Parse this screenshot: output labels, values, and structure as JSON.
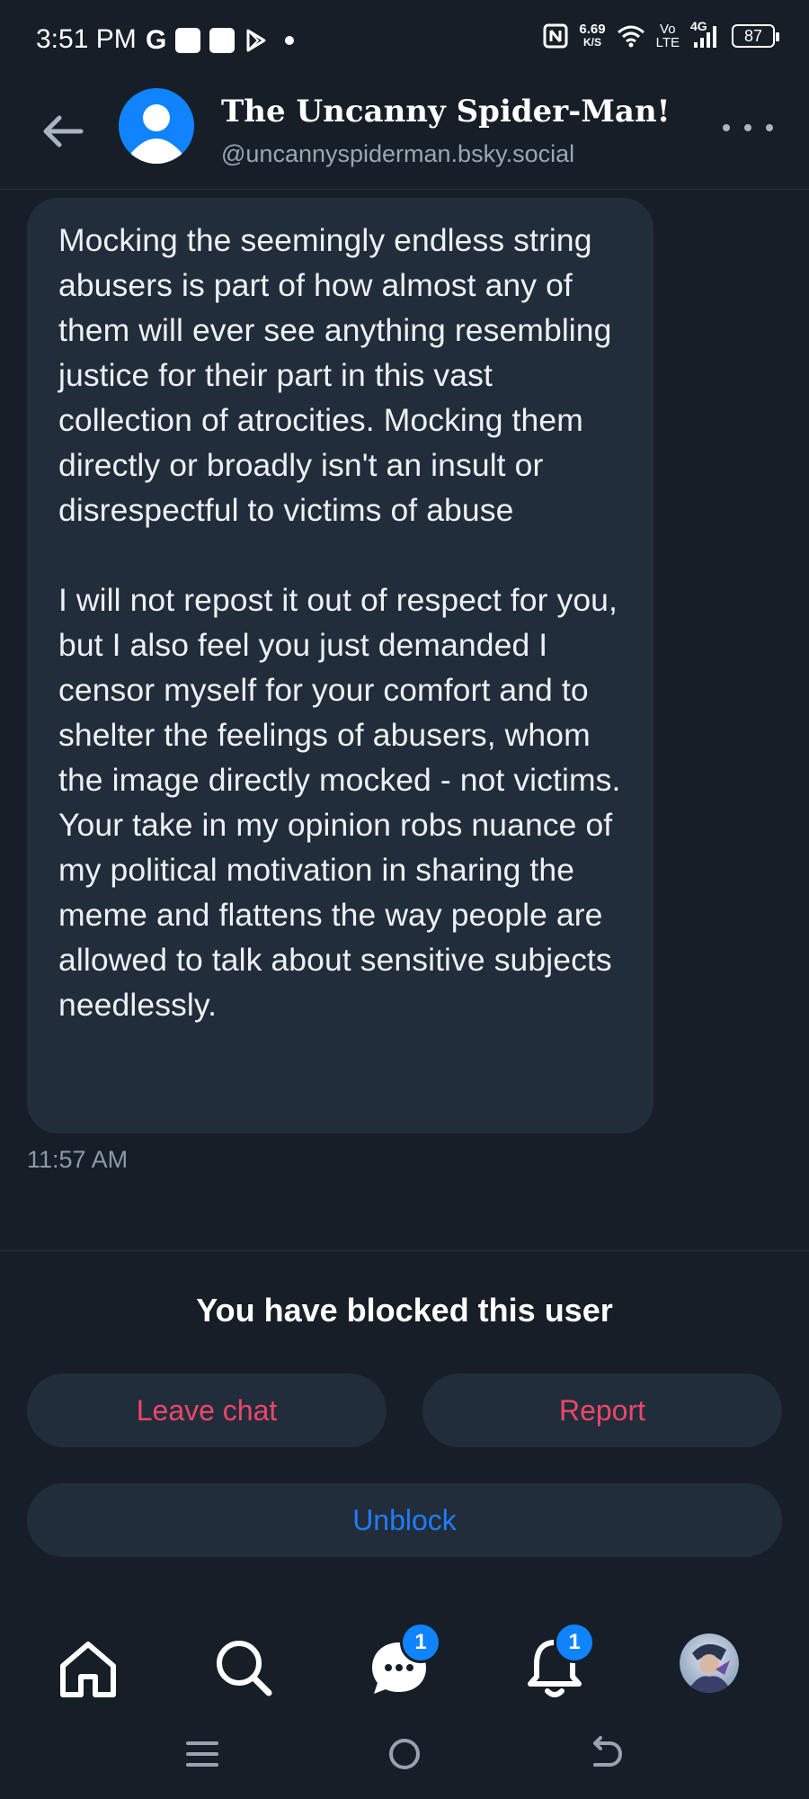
{
  "status_bar": {
    "time": "3:51 PM",
    "g_letter": "G",
    "speed_value": "6.69",
    "speed_unit": "K/S",
    "volte_top": "Vo",
    "volte_bottom": "LTE",
    "network": "4G",
    "battery": "87"
  },
  "header": {
    "display_name": "The Uncanny Spider-Man!",
    "handle": "@uncannyspiderman.bsky.social"
  },
  "message": {
    "paragraph_1": "Mocking the seemingly endless string abusers is part of how almost any of them will ever see anything resembling justice for their part in this vast collection of atrocities. Mocking them directly or broadly isn't an insult or disrespectful to victims of abuse",
    "paragraph_2": "I will not repost it out of respect for you, but I also feel you just demanded I censor myself for your comfort and to shelter the feelings of abusers, whom the image directly mocked - not victims. Your take in my opinion robs nuance of my political motivation in sharing the meme and flattens the way people are allowed to talk about sensitive subjects needlessly.",
    "time": "11:57 AM"
  },
  "blocked_panel": {
    "title": "You have blocked this user",
    "leave_label": "Leave chat",
    "report_label": "Report",
    "unblock_label": "Unblock"
  },
  "bottom_nav": {
    "items": [
      "home-icon",
      "search-icon",
      "chat-icon",
      "bell-icon",
      "profile-avatar"
    ],
    "chat_badge": "1",
    "notifications_badge": "1"
  },
  "colors": {
    "background": "#161e27",
    "bubble": "#222d3b",
    "accent_blue": "#1083fe",
    "danger_red": "#ec4768",
    "muted_text": "#9aa6b4"
  }
}
